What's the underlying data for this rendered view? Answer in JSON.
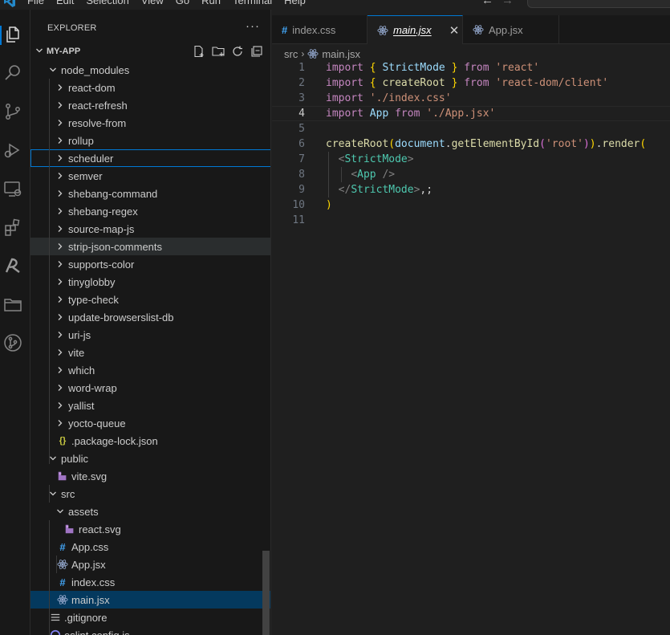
{
  "menu": [
    "File",
    "Edit",
    "Selection",
    "View",
    "Go",
    "Run",
    "Terminal",
    "Help"
  ],
  "nav": {
    "back": "←",
    "forward": "→"
  },
  "activity": [
    {
      "name": "explorer-icon"
    },
    {
      "name": "search-icon"
    },
    {
      "name": "source-control-icon"
    },
    {
      "name": "run-debug-icon"
    },
    {
      "name": "remote-explorer-icon"
    },
    {
      "name": "extensions-icon"
    },
    {
      "name": "prettier-icon"
    },
    {
      "name": "folder-icon"
    },
    {
      "name": "git-graph-icon"
    }
  ],
  "sidebar": {
    "title": "EXPLORER",
    "more": "···",
    "project": "MY-APP",
    "tree": [
      {
        "label": "node_modules",
        "type": "folder-open",
        "depth": 1
      },
      {
        "label": "react-dom",
        "type": "folder",
        "depth": 2
      },
      {
        "label": "react-refresh",
        "type": "folder",
        "depth": 2
      },
      {
        "label": "resolve-from",
        "type": "folder",
        "depth": 2
      },
      {
        "label": "rollup",
        "type": "folder",
        "depth": 2
      },
      {
        "label": "scheduler",
        "type": "folder",
        "depth": 2,
        "state": "focused"
      },
      {
        "label": "semver",
        "type": "folder",
        "depth": 2
      },
      {
        "label": "shebang-command",
        "type": "folder",
        "depth": 2
      },
      {
        "label": "shebang-regex",
        "type": "folder",
        "depth": 2
      },
      {
        "label": "source-map-js",
        "type": "folder",
        "depth": 2
      },
      {
        "label": "strip-json-comments",
        "type": "folder",
        "depth": 2,
        "state": "hover"
      },
      {
        "label": "supports-color",
        "type": "folder",
        "depth": 2
      },
      {
        "label": "tinyglobby",
        "type": "folder",
        "depth": 2
      },
      {
        "label": "type-check",
        "type": "folder",
        "depth": 2
      },
      {
        "label": "update-browserslist-db",
        "type": "folder",
        "depth": 2
      },
      {
        "label": "uri-js",
        "type": "folder",
        "depth": 2
      },
      {
        "label": "vite",
        "type": "folder",
        "depth": 2
      },
      {
        "label": "which",
        "type": "folder",
        "depth": 2
      },
      {
        "label": "word-wrap",
        "type": "folder",
        "depth": 2
      },
      {
        "label": "yallist",
        "type": "folder",
        "depth": 2
      },
      {
        "label": "yocto-queue",
        "type": "folder",
        "depth": 2
      },
      {
        "label": ".package-lock.json",
        "type": "json",
        "depth": 2
      },
      {
        "label": "public",
        "type": "folder-open",
        "depth": 1
      },
      {
        "label": "vite.svg",
        "type": "svg",
        "depth": 2
      },
      {
        "label": "src",
        "type": "folder-open",
        "depth": 1
      },
      {
        "label": "assets",
        "type": "folder-open",
        "depth": 2
      },
      {
        "label": "react.svg",
        "type": "svg",
        "depth": 3
      },
      {
        "label": "App.css",
        "type": "css",
        "depth": 2
      },
      {
        "label": "App.jsx",
        "type": "react",
        "depth": 2
      },
      {
        "label": "index.css",
        "type": "css",
        "depth": 2
      },
      {
        "label": "main.jsx",
        "type": "react",
        "depth": 2,
        "state": "selected"
      },
      {
        "label": ".gitignore",
        "type": "text",
        "depth": 1
      },
      {
        "label": "eslint.config.js",
        "type": "eslint",
        "depth": 1
      }
    ]
  },
  "tabs": [
    {
      "label": "index.css",
      "icon": "css",
      "active": false
    },
    {
      "label": "main.jsx",
      "icon": "react",
      "active": true,
      "close": "✕"
    },
    {
      "label": "App.jsx",
      "icon": "react",
      "active": false
    }
  ],
  "breadcrumb": {
    "folder": "src",
    "sep": "›",
    "file": "main.jsx"
  },
  "code": {
    "line_numbers": [
      "1",
      "2",
      "3",
      "4",
      "5",
      "6",
      "7",
      "8",
      "9",
      "10",
      "11"
    ],
    "current_line": "4",
    "tokens": [
      [
        [
          "kw",
          "import"
        ],
        [
          "plain",
          " "
        ],
        [
          "br1",
          "{"
        ],
        [
          "plain",
          " "
        ],
        [
          "id",
          "StrictMode"
        ],
        [
          "plain",
          " "
        ],
        [
          "br1",
          "}"
        ],
        [
          "plain",
          " "
        ],
        [
          "kw",
          "from"
        ],
        [
          "plain",
          " "
        ],
        [
          "str",
          "'react'"
        ]
      ],
      [
        [
          "kw",
          "import"
        ],
        [
          "plain",
          " "
        ],
        [
          "br1",
          "{"
        ],
        [
          "plain",
          " "
        ],
        [
          "fn",
          "createRoot"
        ],
        [
          "plain",
          " "
        ],
        [
          "br1",
          "}"
        ],
        [
          "plain",
          " "
        ],
        [
          "kw",
          "from"
        ],
        [
          "plain",
          " "
        ],
        [
          "str",
          "'react-dom/client'"
        ]
      ],
      [
        [
          "kw",
          "import"
        ],
        [
          "plain",
          " "
        ],
        [
          "str",
          "'./index.css'"
        ]
      ],
      [
        [
          "kw",
          "import"
        ],
        [
          "plain",
          " "
        ],
        [
          "id",
          "App"
        ],
        [
          "plain",
          " "
        ],
        [
          "kw",
          "from"
        ],
        [
          "plain",
          " "
        ],
        [
          "str",
          "'./App.jsx'"
        ]
      ],
      [],
      [
        [
          "fn",
          "createRoot"
        ],
        [
          "br1",
          "("
        ],
        [
          "id",
          "document"
        ],
        [
          "plain",
          "."
        ],
        [
          "fn",
          "getElementById"
        ],
        [
          "br2",
          "("
        ],
        [
          "str",
          "'root'"
        ],
        [
          "br2",
          ")"
        ],
        [
          "br1",
          ")"
        ],
        [
          "plain",
          "."
        ],
        [
          "fn",
          "render"
        ],
        [
          "br1",
          "("
        ]
      ],
      [
        [
          "plain",
          "  "
        ],
        [
          "ang",
          "<"
        ],
        [
          "tag",
          "StrictMode"
        ],
        [
          "ang",
          ">"
        ]
      ],
      [
        [
          "plain",
          "    "
        ],
        [
          "ang",
          "<"
        ],
        [
          "tag",
          "App"
        ],
        [
          "plain",
          " "
        ],
        [
          "ang",
          "/>"
        ]
      ],
      [
        [
          "plain",
          "  "
        ],
        [
          "ang",
          "</"
        ],
        [
          "tag",
          "StrictMode"
        ],
        [
          "ang",
          ">"
        ],
        [
          "plain",
          ",;"
        ]
      ],
      [
        [
          "br1",
          ")"
        ]
      ],
      []
    ]
  }
}
